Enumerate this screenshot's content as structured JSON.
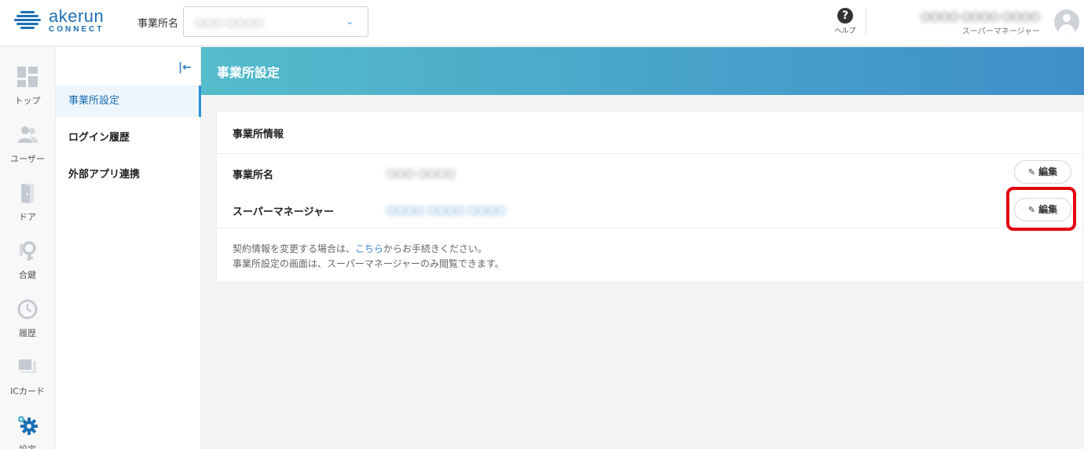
{
  "header": {
    "logo_name": "akerun",
    "logo_sub": "CONNECT",
    "office_label": "事業所名",
    "office_value": "〇〇〇 〇〇〇〇",
    "help_label": "ヘルプ",
    "user_name": "〇〇〇〇 〇〇〇〇 〇〇〇〇",
    "user_role": "スーパーマネージャー"
  },
  "rail": [
    {
      "label": "トップ",
      "icon": "grid-icon"
    },
    {
      "label": "ユーザー",
      "icon": "users-icon"
    },
    {
      "label": "ドア",
      "icon": "door-icon"
    },
    {
      "label": "合鍵",
      "icon": "key-icon"
    },
    {
      "label": "履歴",
      "icon": "history-icon"
    },
    {
      "label": "ICカード",
      "icon": "ic-card-icon"
    },
    {
      "label": "設定",
      "icon": "gear-icon"
    }
  ],
  "subnav": {
    "collapse_icon": "collapse-icon",
    "items": [
      {
        "label": "事業所設定"
      },
      {
        "label": "ログイン履歴"
      },
      {
        "label": "外部アプリ連携"
      }
    ]
  },
  "page": {
    "title": "事業所設定",
    "card_title": "事業所情報",
    "rows": [
      {
        "label": "事業所名",
        "value": "〇〇〇 〇〇〇〇",
        "button": "編集"
      },
      {
        "label": "スーパーマネージャー",
        "value": "〇〇〇〇 〇〇〇〇 〇〇〇〇",
        "button": "編集"
      }
    ],
    "note_line1_pre": "契約情報を変更する場合は、",
    "note_line1_link": "こちら",
    "note_line1_post": "からお手続きください。",
    "note_line2": "事業所設定の画面は、スーパーマネージャーのみ閲覧できます。"
  },
  "colors": {
    "accent": "#2a8fd8",
    "banner_start": "#54bccb",
    "banner_end": "#3f8ec9",
    "highlight": "#e3000f"
  }
}
